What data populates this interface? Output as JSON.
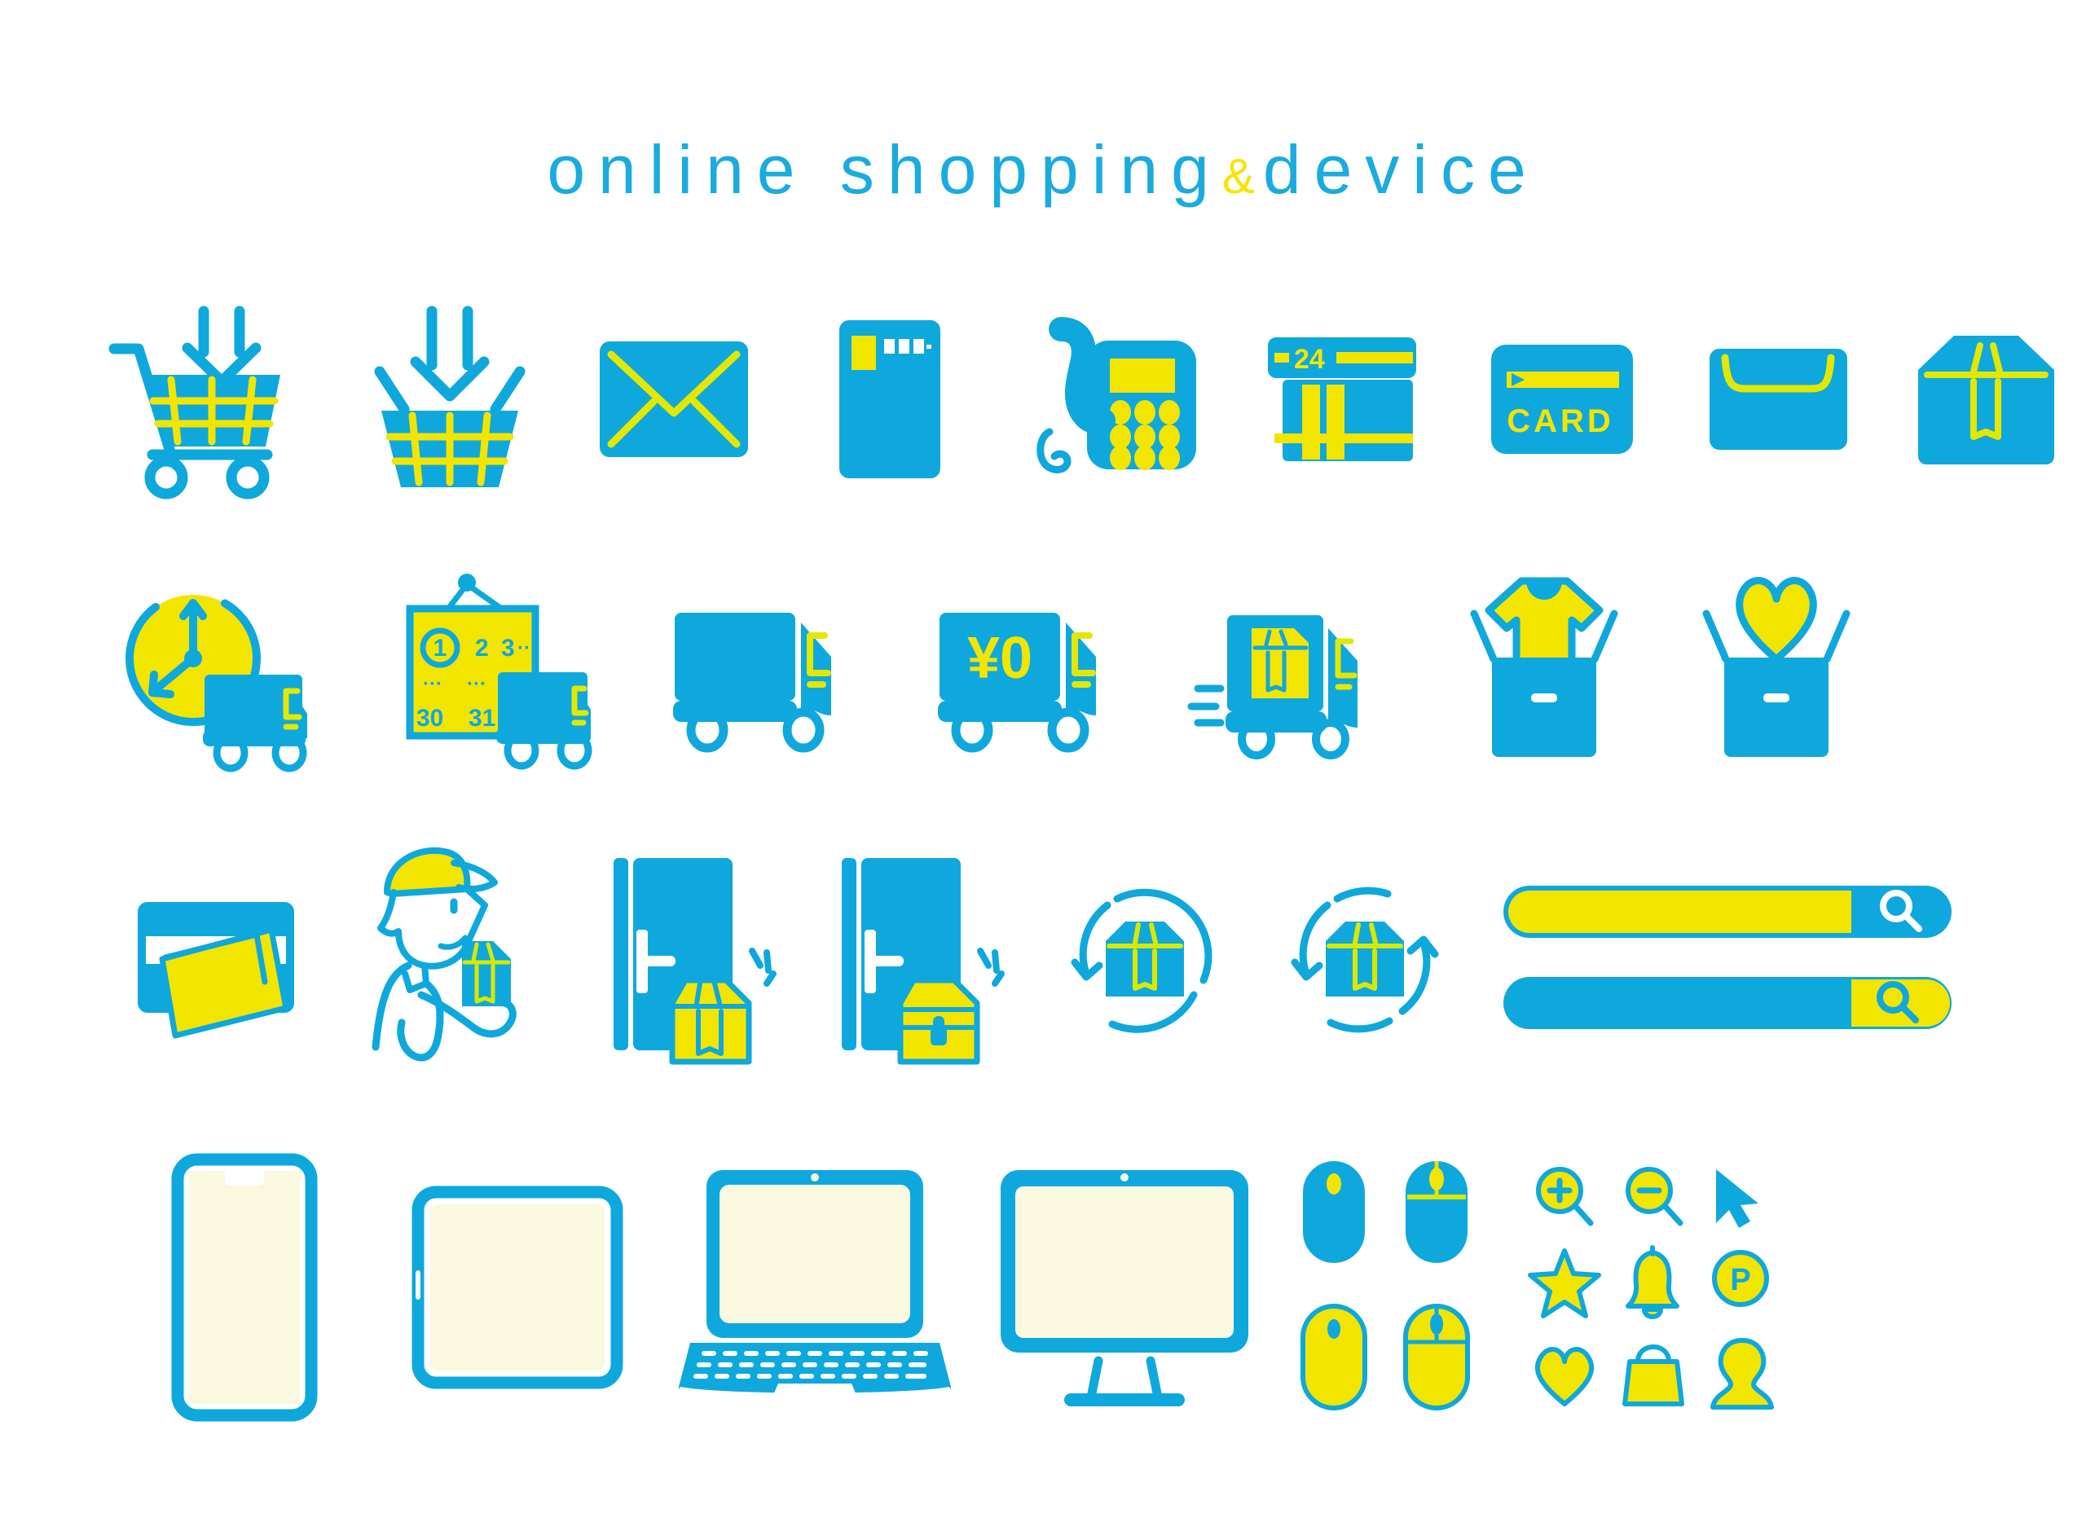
{
  "title": {
    "part1": "online shopping",
    "amp": "&",
    "part2": "device"
  },
  "colors": {
    "blue": "#0FA8DC",
    "yellow": "#F7E500",
    "lime": "#D8E800",
    "screen": "#FBF8E0",
    "white": "#FFFFFF",
    "background": "#FFFFFF"
  },
  "rows": [
    {
      "name": "row-1-shopping-and-payment",
      "items": [
        {
          "id": "shopping-cart-add",
          "label": "shopping cart with down arrow"
        },
        {
          "id": "shopping-basket-add",
          "label": "shopping basket with down arrow"
        },
        {
          "id": "mail-envelope",
          "label": "envelope"
        },
        {
          "id": "postcard",
          "label": "postcard with stamp and postal code"
        },
        {
          "id": "telephone",
          "label": "landline telephone"
        },
        {
          "id": "convenience-store-24",
          "label": "24 hour convenience store",
          "text": "24"
        },
        {
          "id": "credit-card",
          "label": "credit card",
          "text": "CARD"
        },
        {
          "id": "paper-bag",
          "label": "paper envelope pouch"
        },
        {
          "id": "cardboard-box",
          "label": "cardboard box"
        }
      ]
    },
    {
      "name": "row-2-delivery",
      "items": [
        {
          "id": "clock-delivery-truck",
          "label": "time specified delivery truck"
        },
        {
          "id": "calendar-delivery-truck",
          "label": "date specified delivery truck",
          "calendar": {
            "line1": [
              "1",
              "2",
              "3",
              "···"
            ],
            "line2": [
              "···",
              "···"
            ],
            "line3": [
              "30",
              "31"
            ]
          }
        },
        {
          "id": "delivery-truck",
          "label": "delivery truck"
        },
        {
          "id": "free-shipping-truck",
          "label": "free shipping truck",
          "text": "¥0"
        },
        {
          "id": "express-delivery-truck",
          "label": "express delivery truck with package"
        },
        {
          "id": "bag-with-tshirt",
          "label": "shopping bag with t-shirt"
        },
        {
          "id": "bag-with-heart",
          "label": "shopping bag with heart"
        }
      ]
    },
    {
      "name": "row-3-receiving-and-search",
      "items": [
        {
          "id": "mailbox-with-letter",
          "label": "mailbox with letter"
        },
        {
          "id": "delivery-person",
          "label": "delivery person holding package"
        },
        {
          "id": "door-package-delivery",
          "label": "package left at door"
        },
        {
          "id": "door-locked-delivery-box",
          "label": "locked delivery box at door"
        },
        {
          "id": "return-package",
          "label": "package return arrow"
        },
        {
          "id": "exchange-package",
          "label": "package exchange arrows"
        },
        {
          "id": "search-bars",
          "label": "search bars",
          "bars": [
            {
              "id": "search-bar-yellow",
              "placeholder": ""
            },
            {
              "id": "search-bar-blue",
              "placeholder": ""
            }
          ]
        }
      ]
    },
    {
      "name": "row-4-devices",
      "items": [
        {
          "id": "smartphone",
          "label": "smartphone"
        },
        {
          "id": "tablet",
          "label": "tablet"
        },
        {
          "id": "laptop",
          "label": "laptop computer"
        },
        {
          "id": "desktop-monitor",
          "label": "desktop monitor"
        },
        {
          "id": "mouse-grid",
          "label": "computer mice",
          "mice": [
            {
              "id": "mouse-blue-plain",
              "style": "blue-plain"
            },
            {
              "id": "mouse-blue-split",
              "style": "blue-split"
            },
            {
              "id": "mouse-yellow-plain",
              "style": "yellow-plain"
            },
            {
              "id": "mouse-yellow-split",
              "style": "yellow-split"
            }
          ]
        },
        {
          "id": "ui-icon-grid",
          "label": "interface icons",
          "icons": [
            {
              "id": "zoom-in-icon",
              "label": "zoom in magnifier"
            },
            {
              "id": "zoom-out-icon",
              "label": "zoom out magnifier"
            },
            {
              "id": "cursor-icon",
              "label": "mouse cursor arrow"
            },
            {
              "id": "star-icon",
              "label": "star"
            },
            {
              "id": "bell-icon",
              "label": "notification bell"
            },
            {
              "id": "point-badge-icon",
              "label": "point badge",
              "text": "P"
            },
            {
              "id": "heart-icon",
              "label": "heart"
            },
            {
              "id": "handbag-icon",
              "label": "handbag"
            },
            {
              "id": "user-icon",
              "label": "user person"
            }
          ]
        }
      ]
    }
  ]
}
